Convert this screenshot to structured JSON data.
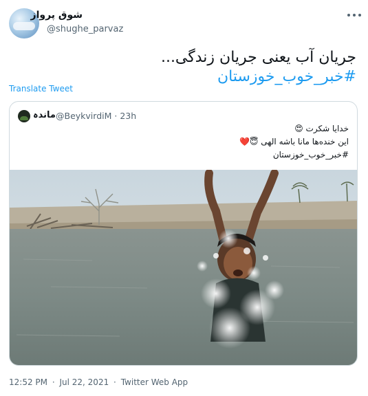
{
  "author": {
    "display_name": "شوق پرواز",
    "handle": "@shughe_parvaz"
  },
  "tweet": {
    "text": "جریان آب یعنی جریان زندگی...",
    "hashtag": "#خبر_خوب_خوزستان"
  },
  "translate_label": "Translate Tweet",
  "quoted": {
    "display_name": "ماندہ",
    "handle": "@BeykvirdiM",
    "time": "· 23h",
    "lines": [
      "خدایا شکرت 😍",
      "این خنده‌ها مانا باشه الهی 😇❤️"
    ],
    "hashtag": "#خبر_خوب_خوزستان"
  },
  "footer": {
    "time": "12:52 PM",
    "date": "Jul 22, 2021",
    "source": "Twitter Web App",
    "separator": "·"
  },
  "icons": {
    "more": "more-horizontal-icon"
  },
  "colors": {
    "link": "#1d9bf0",
    "secondary_text": "#536471",
    "border": "#cfd9de"
  }
}
